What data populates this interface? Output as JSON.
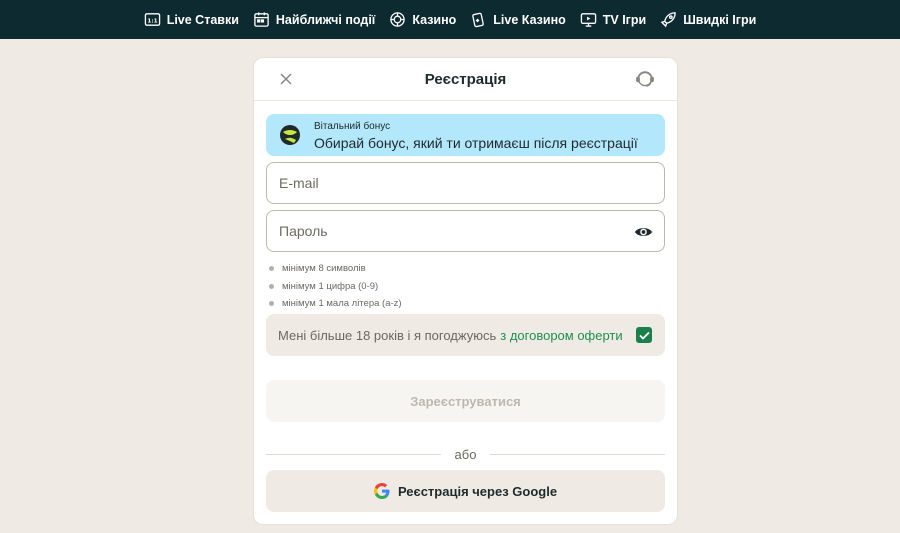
{
  "nav": {
    "items": [
      {
        "label": "Live Ставки",
        "icon": "live-bets-icon"
      },
      {
        "label": "Найближчі події",
        "icon": "calendar-icon"
      },
      {
        "label": "Казино",
        "icon": "casino-chip-icon"
      },
      {
        "label": "Live Казино",
        "icon": "cards-icon"
      },
      {
        "label": "TV Ігри",
        "icon": "tv-icon"
      },
      {
        "label": "Швидкі Ігри",
        "icon": "rocket-icon"
      }
    ]
  },
  "modal": {
    "title": "Реєстрація",
    "bonus": {
      "label": "Вітальний бонус",
      "text": "Обирай бонус, який ти отримаєш після реєстрації"
    },
    "email": {
      "placeholder": "E-mail",
      "value": ""
    },
    "password": {
      "placeholder": "Пароль",
      "value": ""
    },
    "rules": [
      "мінімум 8 символів",
      "мінімум 1 цифра (0-9)",
      "мінімум 1 мала літера (a-z)"
    ],
    "agree": {
      "text": "Мені більше 18 років і я погоджуюсь",
      "link": "з договором оферти",
      "checked": true
    },
    "submit_label": "Зареєструватися",
    "or_label": "або",
    "google_label": "Реєстрація через Google"
  },
  "colors": {
    "topbar": "#0c2a30",
    "background": "#efebe4",
    "bonus_bg": "#b3e7fb",
    "accent_green": "#1a7f4b"
  }
}
